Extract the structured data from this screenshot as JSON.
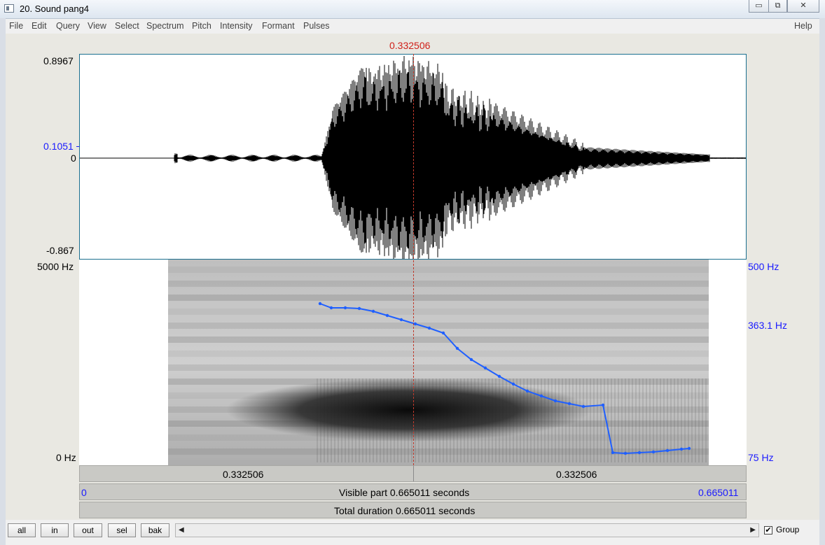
{
  "window": {
    "title": "20. Sound pang4"
  },
  "menu": {
    "items": [
      "File",
      "Edit",
      "Query",
      "View",
      "Select",
      "Spectrum",
      "Pitch",
      "Intensity",
      "Formant",
      "Pulses"
    ],
    "help": "Help"
  },
  "cursor": {
    "time_label": "0.332506"
  },
  "waveform": {
    "y_max": "0.8967",
    "y_cursor": "0.1051",
    "y_zero": "0",
    "y_min": "-0.867"
  },
  "spectrogram": {
    "freq_top": "5000 Hz",
    "freq_bottom": "0 Hz"
  },
  "pitch": {
    "top": "500 Hz",
    "mid": "363.1 Hz",
    "bottom": "75 Hz",
    "color": "#1f5fff"
  },
  "timebar": {
    "left_segment": "0.332506",
    "right_segment": "0.332506"
  },
  "visible": {
    "start": "0",
    "label": "Visible part 0.665011 seconds",
    "end": "0.665011"
  },
  "total": {
    "label": "Total duration 0.665011 seconds"
  },
  "buttons": {
    "all": "all",
    "in": "in",
    "out": "out",
    "sel": "sel",
    "bak": "bak"
  },
  "group": {
    "label": "Group",
    "checked": true
  },
  "colors": {
    "cursor": "#d0201a",
    "axis_blue": "#1a1aff",
    "frame": "#1b6f8f"
  }
}
